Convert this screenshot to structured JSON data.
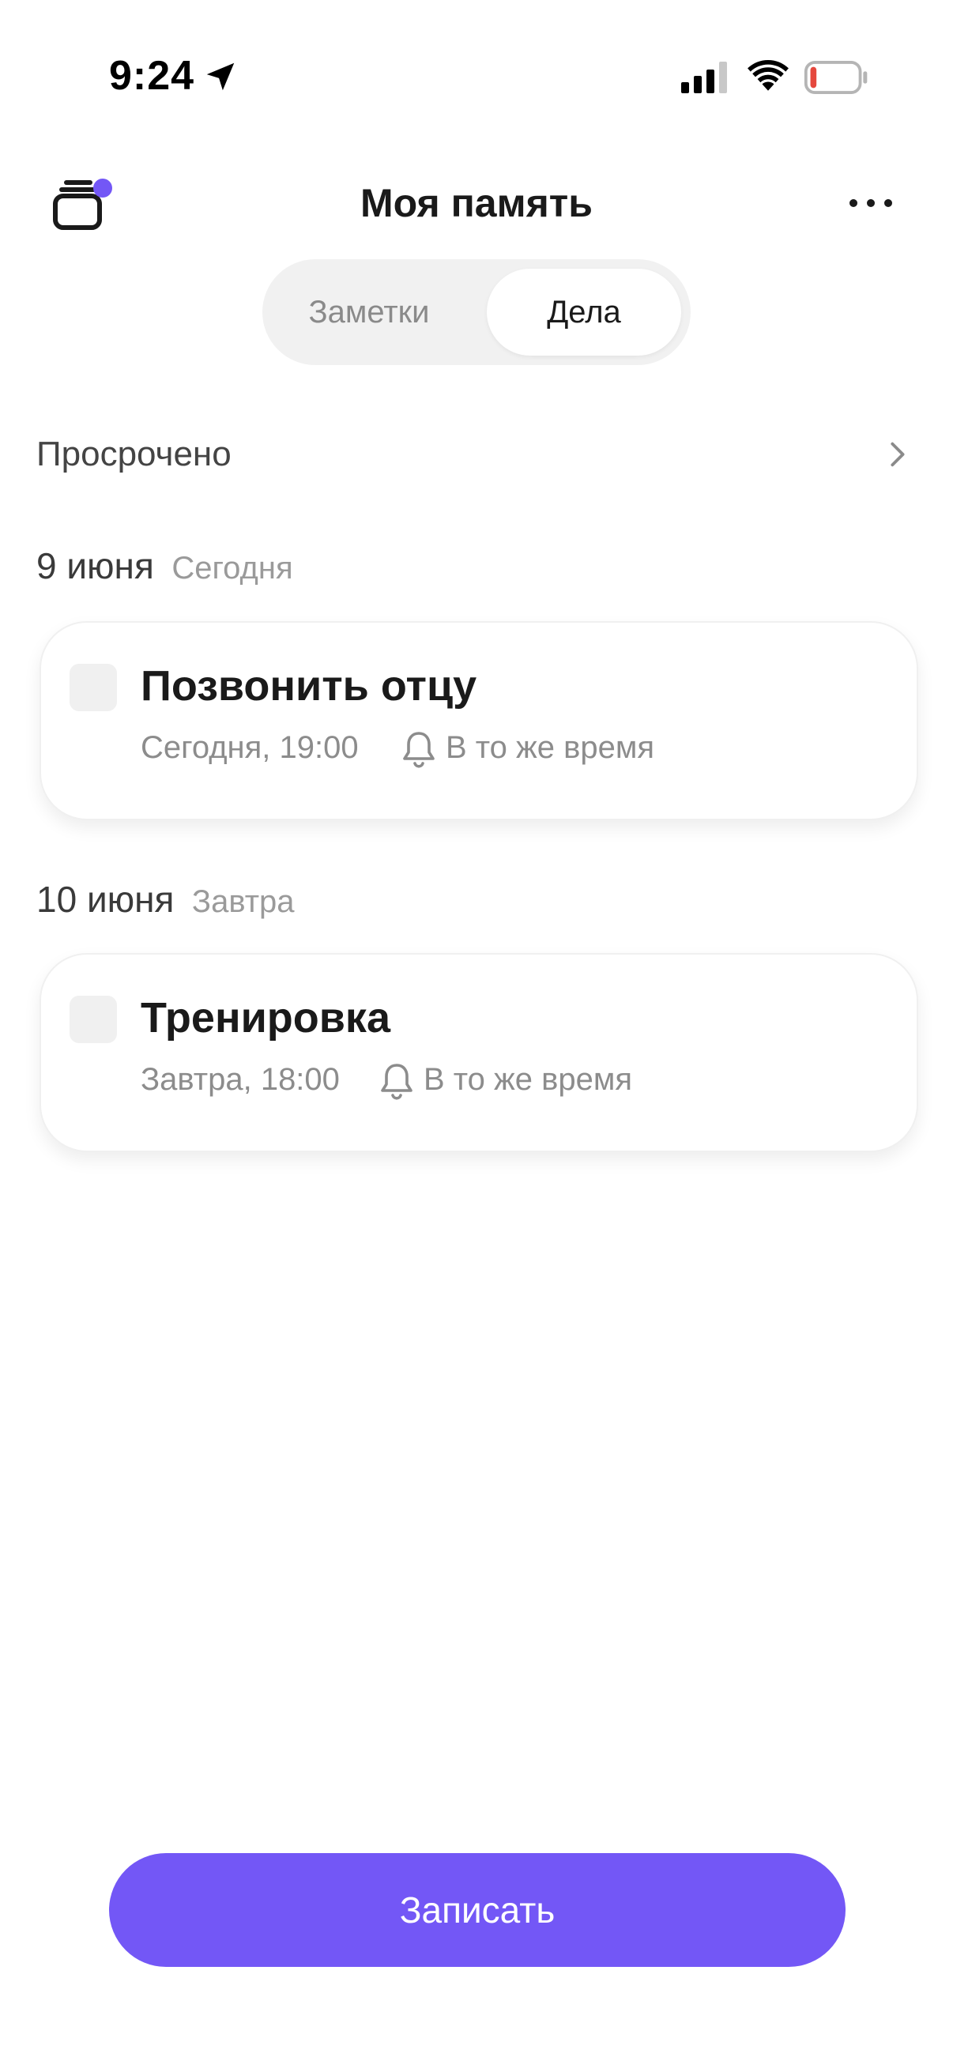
{
  "status_bar": {
    "time": "9:24",
    "battery_color": "#e5483e"
  },
  "header": {
    "title": "Моя память",
    "badge_color": "#7357f6"
  },
  "tabs": {
    "items": [
      {
        "label": "Заметки",
        "selected": false
      },
      {
        "label": "Дела",
        "selected": true
      }
    ]
  },
  "overdue": {
    "label": "Просрочено"
  },
  "groups": [
    {
      "date": "9 июня",
      "relative": "Сегодня",
      "tasks": [
        {
          "title": "Позвонить отцу",
          "when": "Сегодня, 19:00",
          "reminder": "В то же время",
          "done": false
        }
      ]
    },
    {
      "date": "10 июня",
      "relative": "Завтра",
      "tasks": [
        {
          "title": "Тренировка",
          "when": "Завтра, 18:00",
          "reminder": "В то же время",
          "done": false
        }
      ]
    }
  ],
  "bottom": {
    "record_label": "Записать",
    "accent": "#7357f6"
  }
}
